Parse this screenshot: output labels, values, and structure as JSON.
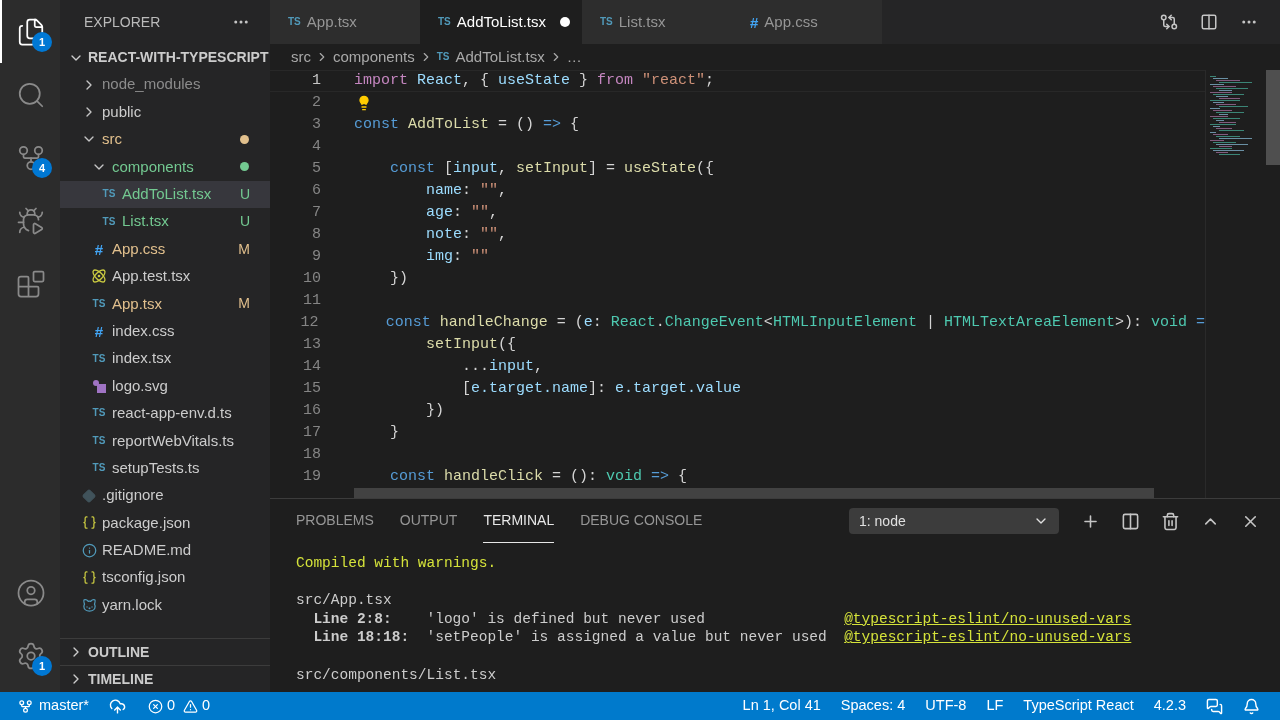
{
  "activity_bar": {
    "top": [
      {
        "kind": "explorer",
        "badge": "1",
        "selected": true
      },
      {
        "kind": "search",
        "selected": false
      },
      {
        "kind": "source_control",
        "badge": "4",
        "selected": false
      },
      {
        "kind": "run",
        "selected": false
      },
      {
        "kind": "extensions",
        "selected": false
      }
    ],
    "bottom": [
      {
        "kind": "account"
      },
      {
        "kind": "settings",
        "badge": "1"
      }
    ]
  },
  "sidebar": {
    "title": "EXPLORER",
    "root": {
      "label": "REACT-WITH-TYPESCRIPT",
      "expanded": true,
      "children": [
        {
          "kind": "folder",
          "label": "node_modules",
          "expanded": false,
          "color": "#8c8c8c",
          "selected": false
        },
        {
          "kind": "folder",
          "label": "public",
          "expanded": false,
          "selected": false
        },
        {
          "kind": "folder",
          "label": "src",
          "expanded": true,
          "color": "#e2c08d",
          "dot": true,
          "selected": false,
          "children": [
            {
              "kind": "folder",
              "label": "components",
              "expanded": true,
              "color": "#73c991",
              "dot": true,
              "selected": false,
              "children": [
                {
                  "kind": "ts",
                  "icon": "TS",
                  "label": "AddToList.tsx",
                  "color": "#73c991",
                  "badge": "U",
                  "selected": true
                },
                {
                  "kind": "ts",
                  "icon": "TS",
                  "label": "List.tsx",
                  "color": "#73c991",
                  "badge": "U",
                  "selected": false
                }
              ]
            },
            {
              "kind": "css",
              "icon": "#",
              "label": "App.css",
              "color": "#e2c08d",
              "badge": "M",
              "selected": false
            },
            {
              "kind": "react",
              "label": "App.test.tsx",
              "selected": false
            },
            {
              "kind": "ts",
              "icon": "TS",
              "label": "App.tsx",
              "color": "#e2c08d",
              "badge": "M",
              "selected": false
            },
            {
              "kind": "css",
              "icon": "#",
              "label": "index.css",
              "selected": false
            },
            {
              "kind": "ts",
              "icon": "TS",
              "label": "index.tsx",
              "selected": false
            },
            {
              "kind": "svg",
              "label": "logo.svg",
              "selected": false
            },
            {
              "kind": "ts",
              "icon": "TS",
              "label": "react-app-env.d.ts",
              "selected": false
            },
            {
              "kind": "ts",
              "icon": "TS",
              "label": "reportWebVitals.ts",
              "selected": false
            },
            {
              "kind": "ts",
              "icon": "TS",
              "label": "setupTests.ts",
              "selected": false
            }
          ]
        },
        {
          "kind": "git",
          "label": ".gitignore",
          "selected": false
        },
        {
          "kind": "json",
          "label": "package.json",
          "selected": false
        },
        {
          "kind": "info",
          "label": "README.md",
          "selected": false
        },
        {
          "kind": "json",
          "label": "tsconfig.json",
          "selected": false
        },
        {
          "kind": "yarn",
          "label": "yarn.lock",
          "selected": false
        }
      ]
    },
    "sections": [
      {
        "label": "OUTLINE",
        "expanded": false
      },
      {
        "label": "TIMELINE",
        "expanded": false
      }
    ]
  },
  "tabs": [
    {
      "kind": "ts",
      "icon": "TS",
      "label": "App.tsx",
      "selected": false,
      "dirty": false
    },
    {
      "kind": "ts",
      "icon": "TS",
      "label": "AddToList.tsx",
      "selected": true,
      "dirty": true
    },
    {
      "kind": "ts",
      "icon": "TS",
      "label": "List.tsx",
      "selected": false,
      "dirty": false
    },
    {
      "kind": "css",
      "icon": "#",
      "label": "App.css",
      "selected": false,
      "dirty": false
    }
  ],
  "breadcrumb": [
    {
      "label": "src"
    },
    {
      "label": "components"
    },
    {
      "kind": "ts",
      "icon": "TS",
      "label": "AddToList.tsx"
    },
    {
      "label": "…"
    }
  ],
  "editor": {
    "lines": [
      {
        "number": "1",
        "current": true,
        "tokens": [
          {
            "text": "import",
            "kind": "control"
          },
          {
            "text": " React",
            "kind": "variable"
          },
          {
            "text": ", { ",
            "kind": "plain"
          },
          {
            "text": "useState",
            "kind": "variable"
          },
          {
            "text": " } ",
            "kind": "plain"
          },
          {
            "text": "from",
            "kind": "control"
          },
          {
            "text": " \"react\"",
            "kind": "string"
          },
          {
            "text": ";",
            "kind": "plain"
          }
        ]
      },
      {
        "number": "2",
        "current": false,
        "lightbulb": true
      },
      {
        "number": "3",
        "current": false,
        "tokens": [
          {
            "text": "const",
            "kind": "storage"
          },
          {
            "text": " AddToList",
            "kind": "function"
          },
          {
            "text": " = () ",
            "kind": "plain"
          },
          {
            "text": "=>",
            "kind": "storage"
          },
          {
            "text": " {",
            "kind": "plain"
          }
        ]
      },
      {
        "number": "4",
        "current": false
      },
      {
        "number": "5",
        "current": false,
        "tokens": [
          {
            "text": "    const",
            "kind": "storage"
          },
          {
            "text": " [",
            "kind": "plain"
          },
          {
            "text": "input",
            "kind": "variable"
          },
          {
            "text": ", ",
            "kind": "plain"
          },
          {
            "text": "setInput",
            "kind": "function"
          },
          {
            "text": "] = ",
            "kind": "plain"
          },
          {
            "text": "useState",
            "kind": "function"
          },
          {
            "text": "({",
            "kind": "plain"
          }
        ]
      },
      {
        "number": "6",
        "current": false,
        "tokens": [
          {
            "text": "        name",
            "kind": "variable"
          },
          {
            "text": ": ",
            "kind": "plain"
          },
          {
            "text": "\"\"",
            "kind": "string"
          },
          {
            "text": ",",
            "kind": "plain"
          }
        ]
      },
      {
        "number": "7",
        "current": false,
        "tokens": [
          {
            "text": "        age",
            "kind": "variable"
          },
          {
            "text": ": ",
            "kind": "plain"
          },
          {
            "text": "\"\"",
            "kind": "string"
          },
          {
            "text": ",",
            "kind": "plain"
          }
        ]
      },
      {
        "number": "8",
        "current": false,
        "tokens": [
          {
            "text": "        note",
            "kind": "variable"
          },
          {
            "text": ": ",
            "kind": "plain"
          },
          {
            "text": "\"\"",
            "kind": "string"
          },
          {
            "text": ",",
            "kind": "plain"
          }
        ]
      },
      {
        "number": "9",
        "current": false,
        "tokens": [
          {
            "text": "        img",
            "kind": "variable"
          },
          {
            "text": ": ",
            "kind": "plain"
          },
          {
            "text": "\"\"",
            "kind": "string"
          }
        ]
      },
      {
        "number": "10",
        "current": false,
        "tokens": [
          {
            "text": "    })",
            "kind": "plain"
          }
        ]
      },
      {
        "number": "11",
        "current": false
      },
      {
        "number": "12",
        "current": false,
        "tokens": [
          {
            "text": "    const",
            "kind": "storage"
          },
          {
            "text": " handleChange",
            "kind": "function"
          },
          {
            "text": " = (",
            "kind": "plain"
          },
          {
            "text": "e",
            "kind": "variable"
          },
          {
            "text": ": ",
            "kind": "plain"
          },
          {
            "text": "React",
            "kind": "type"
          },
          {
            "text": ".",
            "kind": "plain"
          },
          {
            "text": "ChangeEvent",
            "kind": "type"
          },
          {
            "text": "<",
            "kind": "plain"
          },
          {
            "text": "HTMLInputElement",
            "kind": "type"
          },
          {
            "text": " | ",
            "kind": "plain"
          },
          {
            "text": "HTMLTextAreaElement",
            "kind": "type"
          },
          {
            "text": ">): ",
            "kind": "plain"
          },
          {
            "text": "void",
            "kind": "type"
          },
          {
            "text": " =",
            "kind": "storage"
          }
        ]
      },
      {
        "number": "13",
        "current": false,
        "tokens": [
          {
            "text": "        setInput",
            "kind": "function"
          },
          {
            "text": "({",
            "kind": "plain"
          }
        ]
      },
      {
        "number": "14",
        "current": false,
        "tokens": [
          {
            "text": "            ...",
            "kind": "plain"
          },
          {
            "text": "input",
            "kind": "variable"
          },
          {
            "text": ",",
            "kind": "plain"
          }
        ]
      },
      {
        "number": "15",
        "current": false,
        "tokens": [
          {
            "text": "            [",
            "kind": "plain"
          },
          {
            "text": "e.target.name",
            "kind": "variable"
          },
          {
            "text": "]: ",
            "kind": "plain"
          },
          {
            "text": "e.target.value",
            "kind": "variable"
          }
        ]
      },
      {
        "number": "16",
        "current": false,
        "tokens": [
          {
            "text": "        })",
            "kind": "plain"
          }
        ]
      },
      {
        "number": "17",
        "current": false,
        "tokens": [
          {
            "text": "    }",
            "kind": "plain"
          }
        ]
      },
      {
        "number": "18",
        "current": false
      },
      {
        "number": "19",
        "current": false,
        "tokens": [
          {
            "text": "    const",
            "kind": "storage"
          },
          {
            "text": " handleClick",
            "kind": "function"
          },
          {
            "text": " = (): ",
            "kind": "plain"
          },
          {
            "text": "void",
            "kind": "type"
          },
          {
            "text": " =>",
            "kind": "storage"
          },
          {
            "text": " {",
            "kind": "plain"
          }
        ]
      }
    ]
  },
  "panel": {
    "tabs": [
      {
        "label": "PROBLEMS",
        "selected": false
      },
      {
        "label": "OUTPUT",
        "selected": false
      },
      {
        "label": "TERMINAL",
        "selected": true
      },
      {
        "label": "DEBUG CONSOLE",
        "selected": false
      }
    ],
    "terminal_select": "1: node",
    "terminal": {
      "status": "Compiled with warnings.",
      "files": [
        {
          "path": "src/App.tsx",
          "warnings": [
            {
              "location": "Line 2:8:",
              "message": "'logo' is defined but never used",
              "rule": "@typescript-eslint/no-unused-vars"
            },
            {
              "location": "Line 18:18:",
              "message": "'setPeople' is assigned a value but never used",
              "rule": "@typescript-eslint/no-unused-vars"
            }
          ]
        },
        {
          "path": "src/components/List.tsx"
        }
      ]
    }
  },
  "status_bar": {
    "branch": "master*",
    "errors": "0",
    "warnings": "0",
    "items": [
      "Ln 1, Col 41",
      "Spaces: 4",
      "UTF-8",
      "LF",
      "TypeScript React",
      "4.2.3"
    ]
  }
}
